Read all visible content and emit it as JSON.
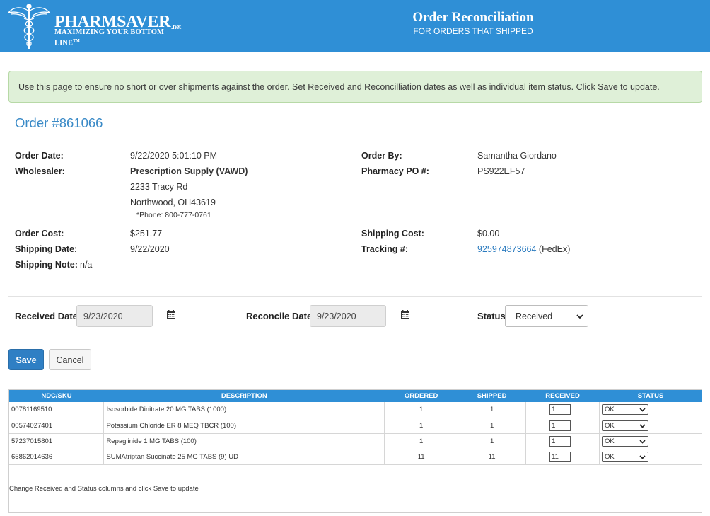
{
  "header": {
    "logo_name": "PHARMSAVER",
    "logo_suffix": ".net",
    "logo_tagline": "MAXIMIZING YOUR BOTTOM LINE",
    "logo_tm": "TM",
    "title": "Order Reconciliation",
    "subtitle": "FOR ORDERS THAT SHIPPED"
  },
  "info_message": "Use this page to ensure no short or over shipments against the order. Set Received and Reconcilliation dates as well as individual item status. Click Save to update.",
  "order": {
    "title": "Order #861066",
    "order_date_label": "Order Date:",
    "order_date": "9/22/2020 5:01:10 PM",
    "wholesaler_label": "Wholesaler:",
    "wholesaler_name": "Prescription Supply (VAWD)",
    "wholesaler_address1": "2233 Tracy Rd",
    "wholesaler_address2": "Northwood, OH43619",
    "wholesaler_phone": "*Phone: 800-777-0761",
    "order_cost_label": "Order Cost:",
    "order_cost": "$251.77",
    "shipping_date_label": "Shipping Date:",
    "shipping_date": "9/22/2020",
    "shipping_note_label": "Shipping Note:",
    "shipping_note": "n/a",
    "order_by_label": "Order By:",
    "order_by": "Samantha Giordano",
    "pharmacy_po_label": "Pharmacy PO #:",
    "pharmacy_po": "PS922EF57",
    "shipping_cost_label": "Shipping Cost:",
    "shipping_cost": "$0.00",
    "tracking_label": "Tracking #:",
    "tracking_number": "925974873664",
    "tracking_carrier": "(FedEx)"
  },
  "form": {
    "received_date_label": "Received Date",
    "received_date": "9/23/2020",
    "reconcile_date_label": "Reconcile Date",
    "reconcile_date": "9/23/2020",
    "status_label": "Status",
    "status_value": "Received",
    "save_label": "Save",
    "cancel_label": "Cancel"
  },
  "table": {
    "headers": [
      "NDC/SKU",
      "DESCRIPTION",
      "ORDERED",
      "SHIPPED",
      "RECEIVED",
      "STATUS"
    ],
    "rows": [
      {
        "ndc": "00781169510",
        "description": "Isosorbide Dinitrate 20 MG TABS (1000)",
        "ordered": "1",
        "shipped": "1",
        "received": "1",
        "status": "OK"
      },
      {
        "ndc": "00574027401",
        "description": "Potassium Chloride ER 8 MEQ TBCR (100)",
        "ordered": "1",
        "shipped": "1",
        "received": "1",
        "status": "OK"
      },
      {
        "ndc": "57237015801",
        "description": "Repaglinide 1 MG TABS (100)",
        "ordered": "1",
        "shipped": "1",
        "received": "1",
        "status": "OK"
      },
      {
        "ndc": "65862014636",
        "description": "SUMAtriptan Succinate 25 MG TABS (9) UD",
        "ordered": "11",
        "shipped": "11",
        "received": "11",
        "status": "OK"
      }
    ],
    "note": "Change Received and Status columns and click Save to update"
  },
  "colors": {
    "header_bg": "#2f8fd6",
    "info_bg": "#dff0d8",
    "save_button": "#2f7fc4",
    "link": "#2b7bbf"
  },
  "icons": {
    "logo": "caduceus-icon",
    "date_picker": "calendar-icon",
    "dropdown": "chevron-down-icon"
  }
}
